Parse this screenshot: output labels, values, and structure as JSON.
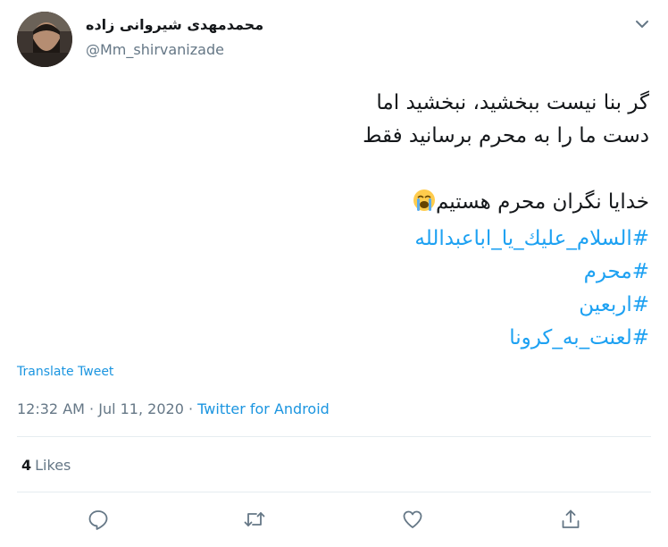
{
  "user": {
    "display_name": "محمدمهدی شیروانی زاده",
    "handle": "@Mm_shirvanizade"
  },
  "tweet": {
    "lines": [
      "گر بنا نیست ببخشید، نبخشید اما",
      "دست ما را به محرم برسانید فقط",
      "",
      "خدایا نگران محرم هستیم"
    ],
    "emoji": "loudly-crying-face",
    "hashtags": [
      "#السلام_عليك_يا_اباعبدالله",
      "#محرم",
      "#اربعين",
      "#لعنت_به_کرونا"
    ]
  },
  "translate_label": "Translate Tweet",
  "meta": {
    "time": "12:32 AM",
    "separator": "·",
    "date": "Jul 11, 2020",
    "source": "Twitter for Android"
  },
  "likes": {
    "count": "4",
    "label": "Likes"
  },
  "icons": {
    "more": "chevron-down-icon",
    "reply": "reply-icon",
    "retweet": "retweet-icon",
    "like": "heart-icon",
    "share": "share-icon"
  },
  "colors": {
    "accent": "#1da1f2",
    "link": "#1b95e0",
    "muted": "#657786",
    "text": "#14171a",
    "divider": "#e6ecf0"
  }
}
